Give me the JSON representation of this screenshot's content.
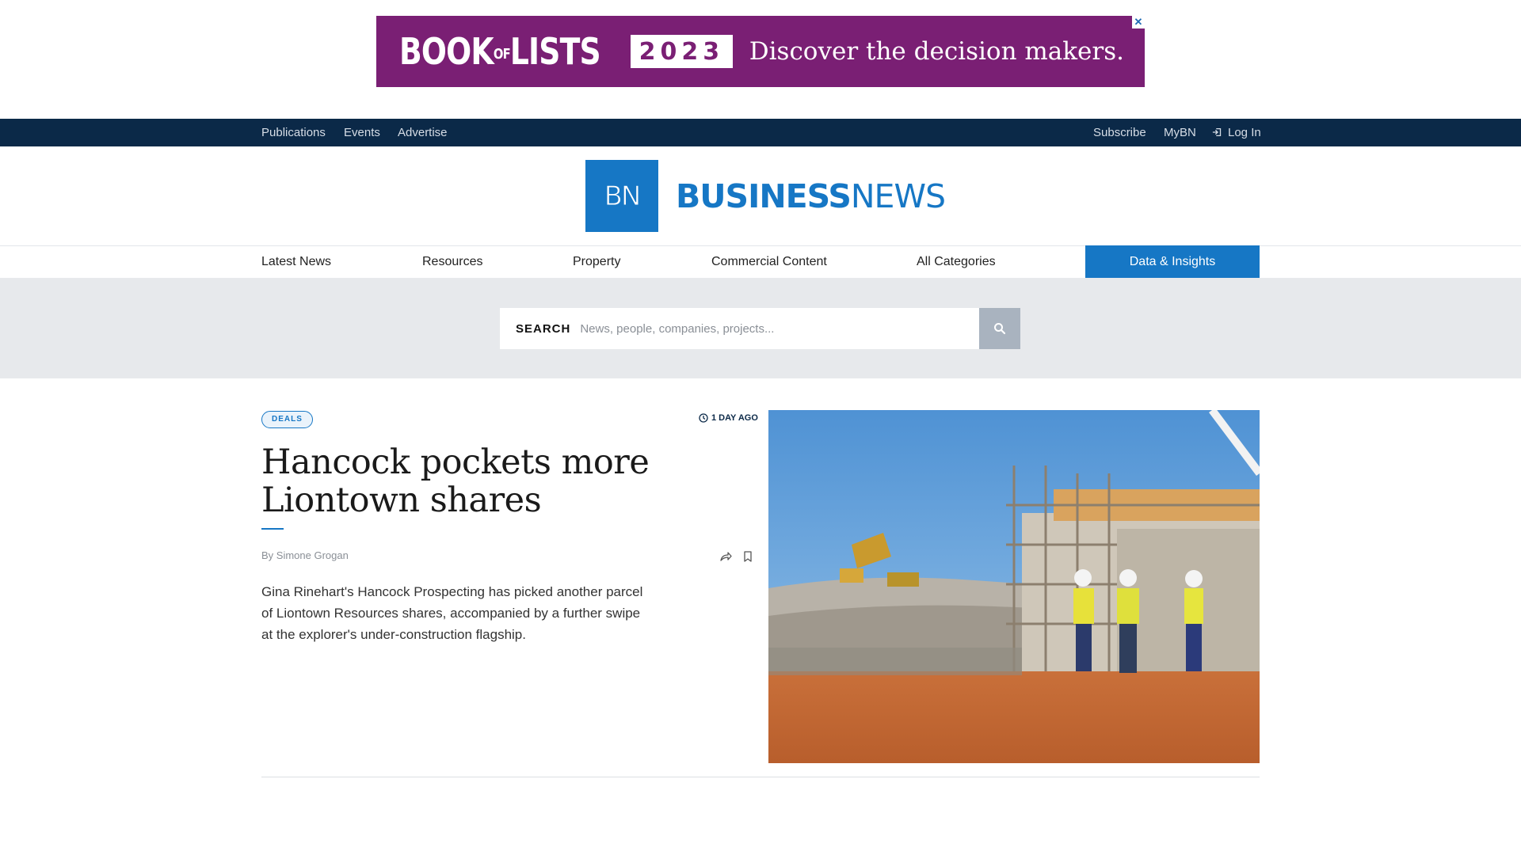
{
  "ad": {
    "brand_book": "BOOK",
    "brand_of": "OF",
    "brand_lists": "LISTS",
    "year": "2023",
    "tagline": "Discover the decision makers.",
    "close": "✕"
  },
  "topbar": {
    "left": [
      "Publications",
      "Events",
      "Advertise"
    ],
    "subscribe": "Subscribe",
    "mybn": "MyBN",
    "login": "Log In"
  },
  "logo": {
    "mark": "BN",
    "word_bold": "BUSINESS",
    "word_light": "NEWS"
  },
  "mainnav": {
    "items": [
      "Latest News",
      "Resources",
      "Property",
      "Commercial Content",
      "All Categories"
    ],
    "data_insights": "Data & Insights"
  },
  "search": {
    "label": "SEARCH",
    "placeholder": "News, people, companies, projects..."
  },
  "article": {
    "tag": "DEALS",
    "time": "1 DAY AGO",
    "headline": "Hancock pockets more Liontown shares",
    "byline_prefix": "By",
    "author": "Simone Grogan",
    "summary": "Gina Rinehart's Hancock Prospecting has picked another parcel of Liontown Resources shares, accompanied by a further swipe at the explorer's under-construction flagship."
  },
  "colors": {
    "brand_blue": "#1677c5",
    "navy": "#0b2948",
    "ad_purple": "#7a1f74"
  }
}
